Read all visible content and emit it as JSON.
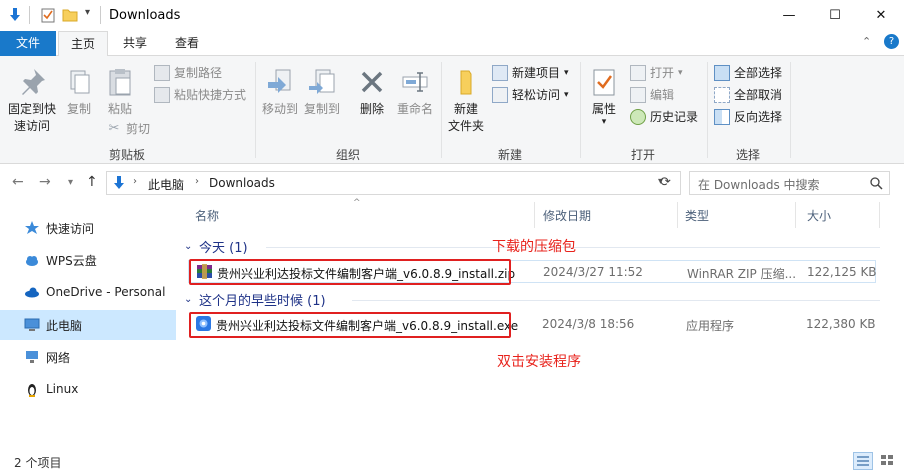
{
  "window": {
    "title": "Downloads",
    "controls": {
      "minimize": "—",
      "maximize": "☐",
      "close": "✕"
    }
  },
  "ribbon_tabs": [
    {
      "label": "文件"
    },
    {
      "label": "主页"
    },
    {
      "label": "共享"
    },
    {
      "label": "查看"
    }
  ],
  "ribbon": {
    "clipboard": {
      "pin_label_1": "固定到快",
      "pin_label_2": "速访问",
      "copy": "复制",
      "paste": "粘贴",
      "copy_path": "复制路径",
      "paste_shortcut": "粘贴快捷方式",
      "cut": "剪切",
      "group": "剪贴板"
    },
    "organize": {
      "move_to": "移动到",
      "copy_to": "复制到",
      "delete": "删除",
      "rename": "重命名",
      "group": "组织"
    },
    "new": {
      "new_folder_1": "新建",
      "new_folder_2": "文件夹",
      "new_item": "新建项目",
      "easy_access": "轻松访问",
      "group": "新建"
    },
    "open": {
      "properties": "属性",
      "open": "打开",
      "edit": "编辑",
      "history": "历史记录",
      "group": "打开"
    },
    "select": {
      "select_all": "全部选择",
      "select_none": "全部取消",
      "invert": "反向选择",
      "group": "选择"
    }
  },
  "address": {
    "path": [
      "此电脑",
      "Downloads"
    ],
    "search_placeholder": "在 Downloads 中搜索"
  },
  "nav": [
    {
      "label": "快速访问",
      "icon": "star-icon"
    },
    {
      "label": "WPS云盘",
      "icon": "cloud-icon"
    },
    {
      "label": "OneDrive - Personal",
      "icon": "onedrive-icon"
    },
    {
      "label": "此电脑",
      "icon": "computer-icon",
      "selected": true
    },
    {
      "label": "网络",
      "icon": "network-icon"
    },
    {
      "label": "Linux",
      "icon": "linux-icon"
    }
  ],
  "columns": {
    "name": "名称",
    "date": "修改日期",
    "type": "类型",
    "size": "大小"
  },
  "groups": [
    {
      "title": "今天 (1)",
      "files": [
        {
          "name": "贵州兴业利达投标文件编制客户端_v6.0.8.9_install.zip",
          "date": "2024/3/27 11:52",
          "type": "WinRAR ZIP 压缩...",
          "size": "122,125 KB"
        }
      ]
    },
    {
      "title": "这个月的早些时候 (1)",
      "files": [
        {
          "name": "贵州兴业利达投标文件编制客户端_v6.0.8.9_install.exe",
          "date": "2024/3/8 18:56",
          "type": "应用程序",
          "size": "122,380 KB"
        }
      ]
    }
  ],
  "annotations": {
    "zip_note": "下载的压缩包",
    "exe_note": "双击安装程序"
  },
  "status": {
    "count": "2 个项目"
  },
  "colors": {
    "accent": "#1979ca",
    "annotation": "#e8231c",
    "selection": "#cce8ff"
  }
}
